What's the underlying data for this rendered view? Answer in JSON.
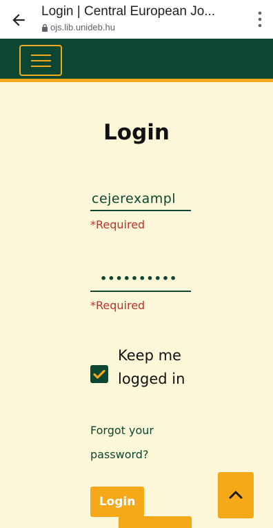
{
  "browser": {
    "title": "Login | Central European Jo...",
    "url": "ojs.lib.unideb.hu"
  },
  "colors": {
    "primary_green": "#0d4731",
    "accent_orange": "#f5a918",
    "background": "#fdf7d9",
    "error_red": "#c0312b"
  },
  "header": {
    "menu_icon": "hamburger-menu-icon"
  },
  "form": {
    "title": "Login",
    "username_value": "cejerexampl",
    "password_value": "••••••••••",
    "required_text_username": "*Required",
    "required_text_password": "*Required",
    "keep_logged_in_label": "Keep me logged in",
    "keep_logged_in_checked": true,
    "forgot_password_label": "Forgot your password?",
    "login_button": "Login"
  }
}
